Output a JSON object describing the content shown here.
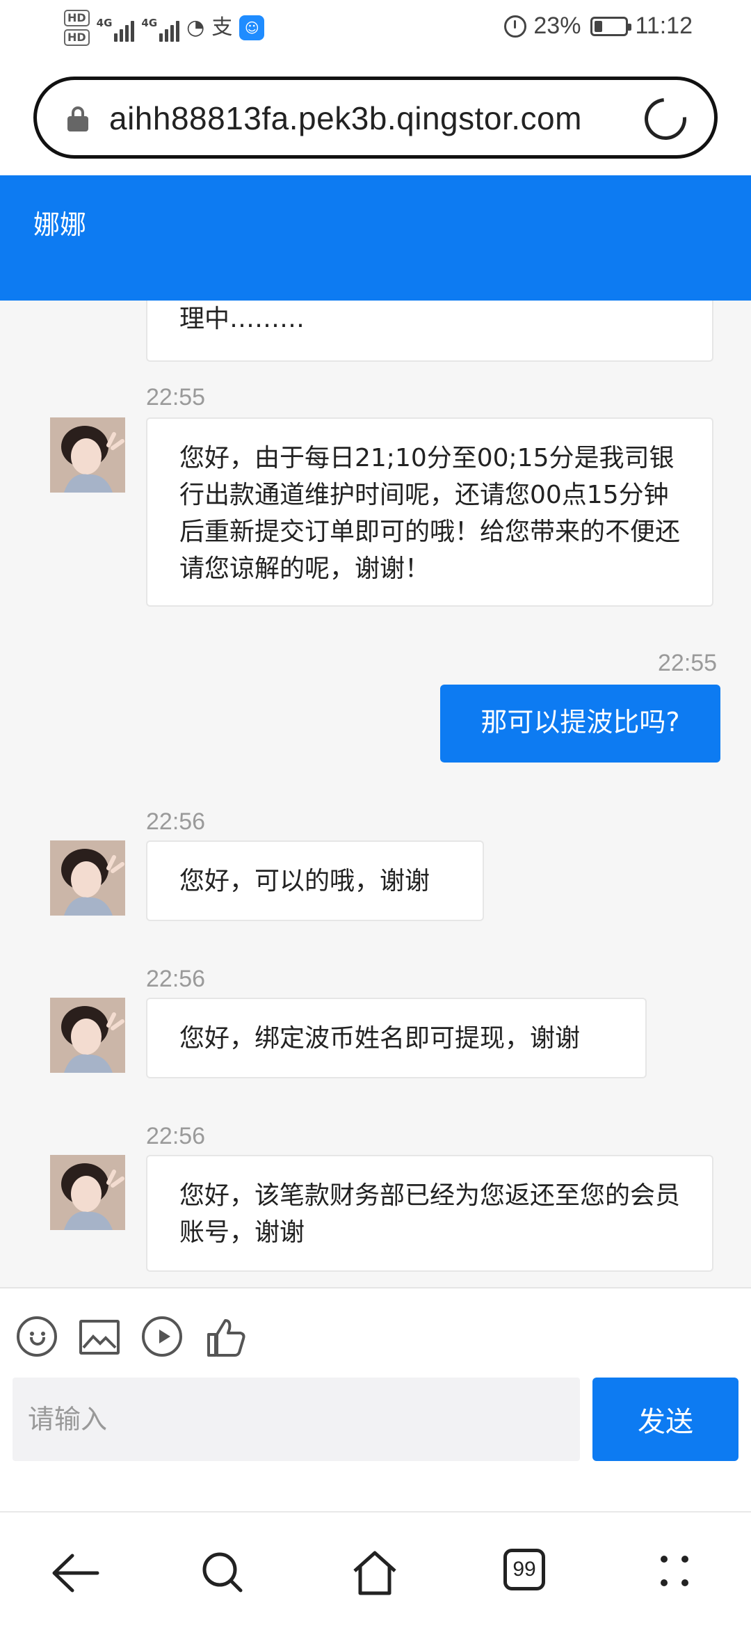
{
  "status_bar": {
    "hd1": "HD",
    "hd2": "HD",
    "net1": "4G",
    "net2": "4G",
    "alipay": "支",
    "battery": "23%",
    "time": "11:12"
  },
  "browser": {
    "url": "aihh88813fa.pek3b.qingstor.com"
  },
  "chat": {
    "title": "娜娜",
    "clipped_text": "理中………",
    "messages": [
      {
        "side": "received",
        "time": "22:55",
        "text": "您好，由于每日21;10分至00;15分是我司银行出款通道维护时间呢，还请您00点15分钟后重新提交订单即可的哦！给您带来的不便还请您谅解的呢，谢谢！"
      },
      {
        "side": "sent",
        "time": "22:55",
        "text": "那可以提波比吗?"
      },
      {
        "side": "received",
        "time": "22:56",
        "text": "您好，可以的哦，谢谢"
      },
      {
        "side": "received",
        "time": "22:56",
        "text": "您好，绑定波币姓名即可提现，谢谢"
      },
      {
        "side": "received",
        "time": "22:56",
        "text": "您好，该笔款财务部已经为您返还至您的会员账号，谢谢"
      }
    ]
  },
  "composer": {
    "placeholder": "请输入",
    "send_label": "发送"
  },
  "nav": {
    "tabs_count": "99"
  },
  "colors": {
    "accent": "#0d7bf2",
    "chat_background": "#f6f6f6"
  },
  "icons": [
    "lock-icon",
    "reload-icon",
    "emoji-icon",
    "image-icon",
    "video-icon",
    "thumbs-up-icon",
    "back-icon",
    "search-icon",
    "home-icon",
    "tabs-icon",
    "more-icon"
  ]
}
